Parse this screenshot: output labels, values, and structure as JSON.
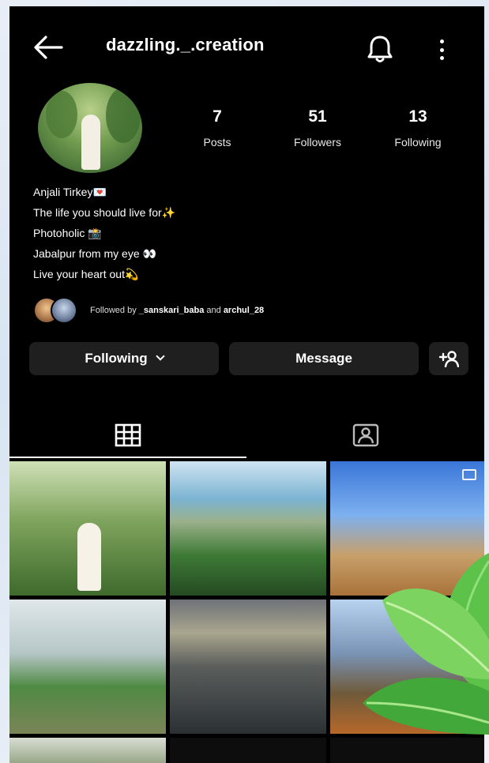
{
  "header": {
    "username": "dazzling._.creation",
    "back_icon": "arrow-left-icon",
    "bell_icon": "bell-icon",
    "more_icon": "more-vertical-icon"
  },
  "profile": {
    "avatar": "profile-avatar",
    "stats": [
      {
        "value": "7",
        "label": "Posts"
      },
      {
        "value": "51",
        "label": "Followers"
      },
      {
        "value": "13",
        "label": "Following"
      }
    ],
    "bio": [
      "Anjali Tirkey💌",
      "The life you should live for✨",
      "Photoholic 📸",
      "Jabalpur from my eye 👀",
      "Live your heart out💫"
    ],
    "followed_by": {
      "prefix": "Followed by",
      "user1": "_sanskari_baba",
      "joiner": "and",
      "user2": "archul_28"
    }
  },
  "actions": {
    "following": "Following",
    "message": "Message",
    "add_user": "+👤"
  },
  "tabs": [
    {
      "name": "grid",
      "icon": "grid-icon"
    },
    {
      "name": "tagged",
      "icon": "tagged-person-icon"
    }
  ],
  "colors": {
    "background": "#000000",
    "button": "#1f1f1f",
    "text": "#ffffff"
  }
}
